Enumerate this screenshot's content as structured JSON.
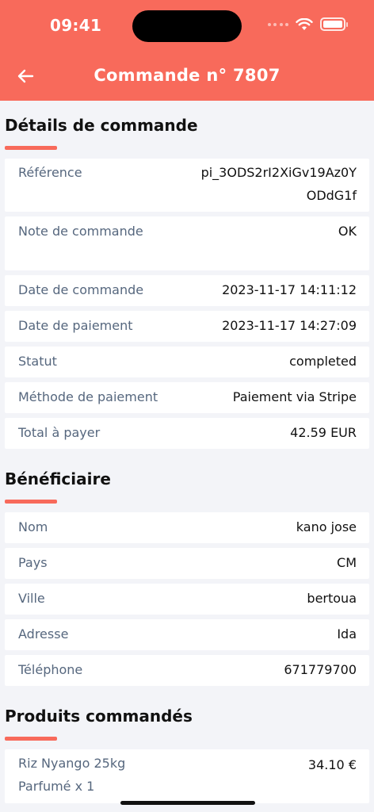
{
  "status_bar": {
    "time": "09:41"
  },
  "header": {
    "title": "Commande n° 7807"
  },
  "sections": {
    "details": {
      "title": "Détails de commande",
      "rows": [
        {
          "label": "Référence",
          "value_line1": "pi_3ODS2rI2XiGv19Az0Y",
          "value_line2": "ODdG1f"
        },
        {
          "label": "Note de commande",
          "value": "OK"
        },
        {
          "label": "Date de commande",
          "value": "2023-11-17 14:11:12"
        },
        {
          "label": "Date de paiement",
          "value": "2023-11-17 14:27:09"
        },
        {
          "label": "Statut",
          "value": "completed"
        },
        {
          "label": "Méthode de paiement",
          "value": "Paiement via Stripe"
        },
        {
          "label": "Total à payer",
          "value": "42.59 EUR"
        }
      ]
    },
    "beneficiary": {
      "title": "Bénéficiaire",
      "rows": [
        {
          "label": "Nom",
          "value": "kano jose"
        },
        {
          "label": "Pays",
          "value": "CM"
        },
        {
          "label": "Ville",
          "value": "bertoua"
        },
        {
          "label": "Adresse",
          "value": "Ida"
        },
        {
          "label": "Téléphone",
          "value": "671779700"
        }
      ]
    },
    "products": {
      "title": "Produits commandés",
      "items": [
        {
          "name_line1": "Riz Nyango 25kg",
          "name_line2": "Parfumé x 1",
          "price": "34.10 €"
        }
      ]
    }
  },
  "colors": {
    "accent": "#f86a5b",
    "background": "#f3f4f8",
    "label": "#56677e"
  }
}
